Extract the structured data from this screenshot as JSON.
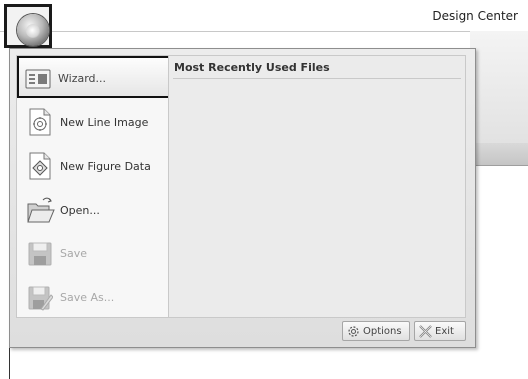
{
  "window": {
    "title": "Design Center"
  },
  "app_menu": {
    "items": [
      {
        "label": "Wizard...",
        "icon": "wizard-icon",
        "enabled": true,
        "highlighted": true
      },
      {
        "label": "New Line Image",
        "icon": "new-line-image-icon",
        "enabled": true
      },
      {
        "label": "New Figure Data",
        "icon": "new-figure-data-icon",
        "enabled": true
      },
      {
        "label": "Open...",
        "icon": "folder-open-icon",
        "enabled": true
      },
      {
        "label": "Save",
        "icon": "save-icon",
        "enabled": false
      },
      {
        "label": "Save As...",
        "icon": "save-as-icon",
        "enabled": false
      }
    ],
    "recent_files_title": "Most Recently Used Files",
    "recent_files": [],
    "options_label": "Options",
    "exit_label": "Exit"
  },
  "colors": {
    "highlight_border": "#111111",
    "menu_bg": "#e6e6e6",
    "disabled_text": "#a8a8a8"
  }
}
